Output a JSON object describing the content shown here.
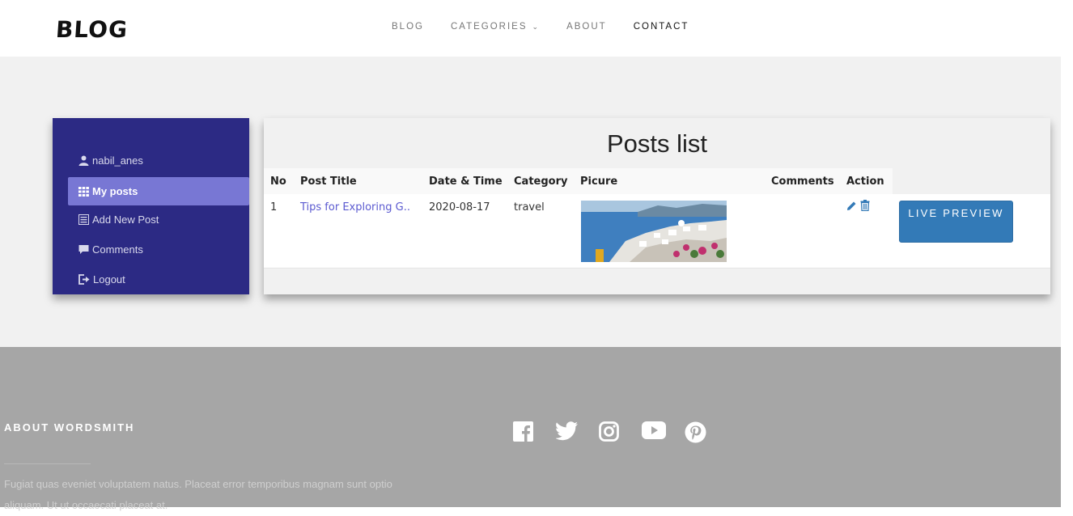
{
  "header": {
    "logo": "BLOG",
    "nav": [
      {
        "label": "BLOG"
      },
      {
        "label": "CATEGORIES"
      },
      {
        "label": "ABOUT"
      },
      {
        "label": "CONTACT"
      }
    ]
  },
  "sidebar": {
    "items": [
      {
        "label": "nabil_anes",
        "icon": "user-icon"
      },
      {
        "label": "My posts",
        "icon": "grid-icon"
      },
      {
        "label": "Add New Post",
        "icon": "list-icon"
      },
      {
        "label": "Comments",
        "icon": "comment-icon"
      },
      {
        "label": "Logout",
        "icon": "logout-icon"
      }
    ]
  },
  "posts": {
    "title": "Posts list",
    "columns": [
      "No",
      "Post Title",
      "Date & Time",
      "Category",
      "Picure",
      "Comments",
      "Action"
    ],
    "rows": [
      {
        "no": "1",
        "title": "Tips for Exploring G..",
        "date": "2020-08-17",
        "category": "travel",
        "comments": "",
        "preview_label": "LIVE PREVIEW"
      }
    ]
  },
  "footer": {
    "about_title": "ABOUT WORDSMITH",
    "about_text": "Fugiat quas eveniet voluptatem natus. Placeat error temporibus magnam sunt optio aliquam. Ut ut occaecati placeat at.",
    "socials": [
      "facebook-icon",
      "twitter-icon",
      "instagram-icon",
      "youtube-icon",
      "pinterest-icon"
    ]
  },
  "colors": {
    "sidebar_bg": "#2c2a84",
    "sidebar_active": "#7877d4",
    "button": "#337ab7",
    "footer_bg": "#a6a6a6",
    "link": "#5b5ad0"
  }
}
